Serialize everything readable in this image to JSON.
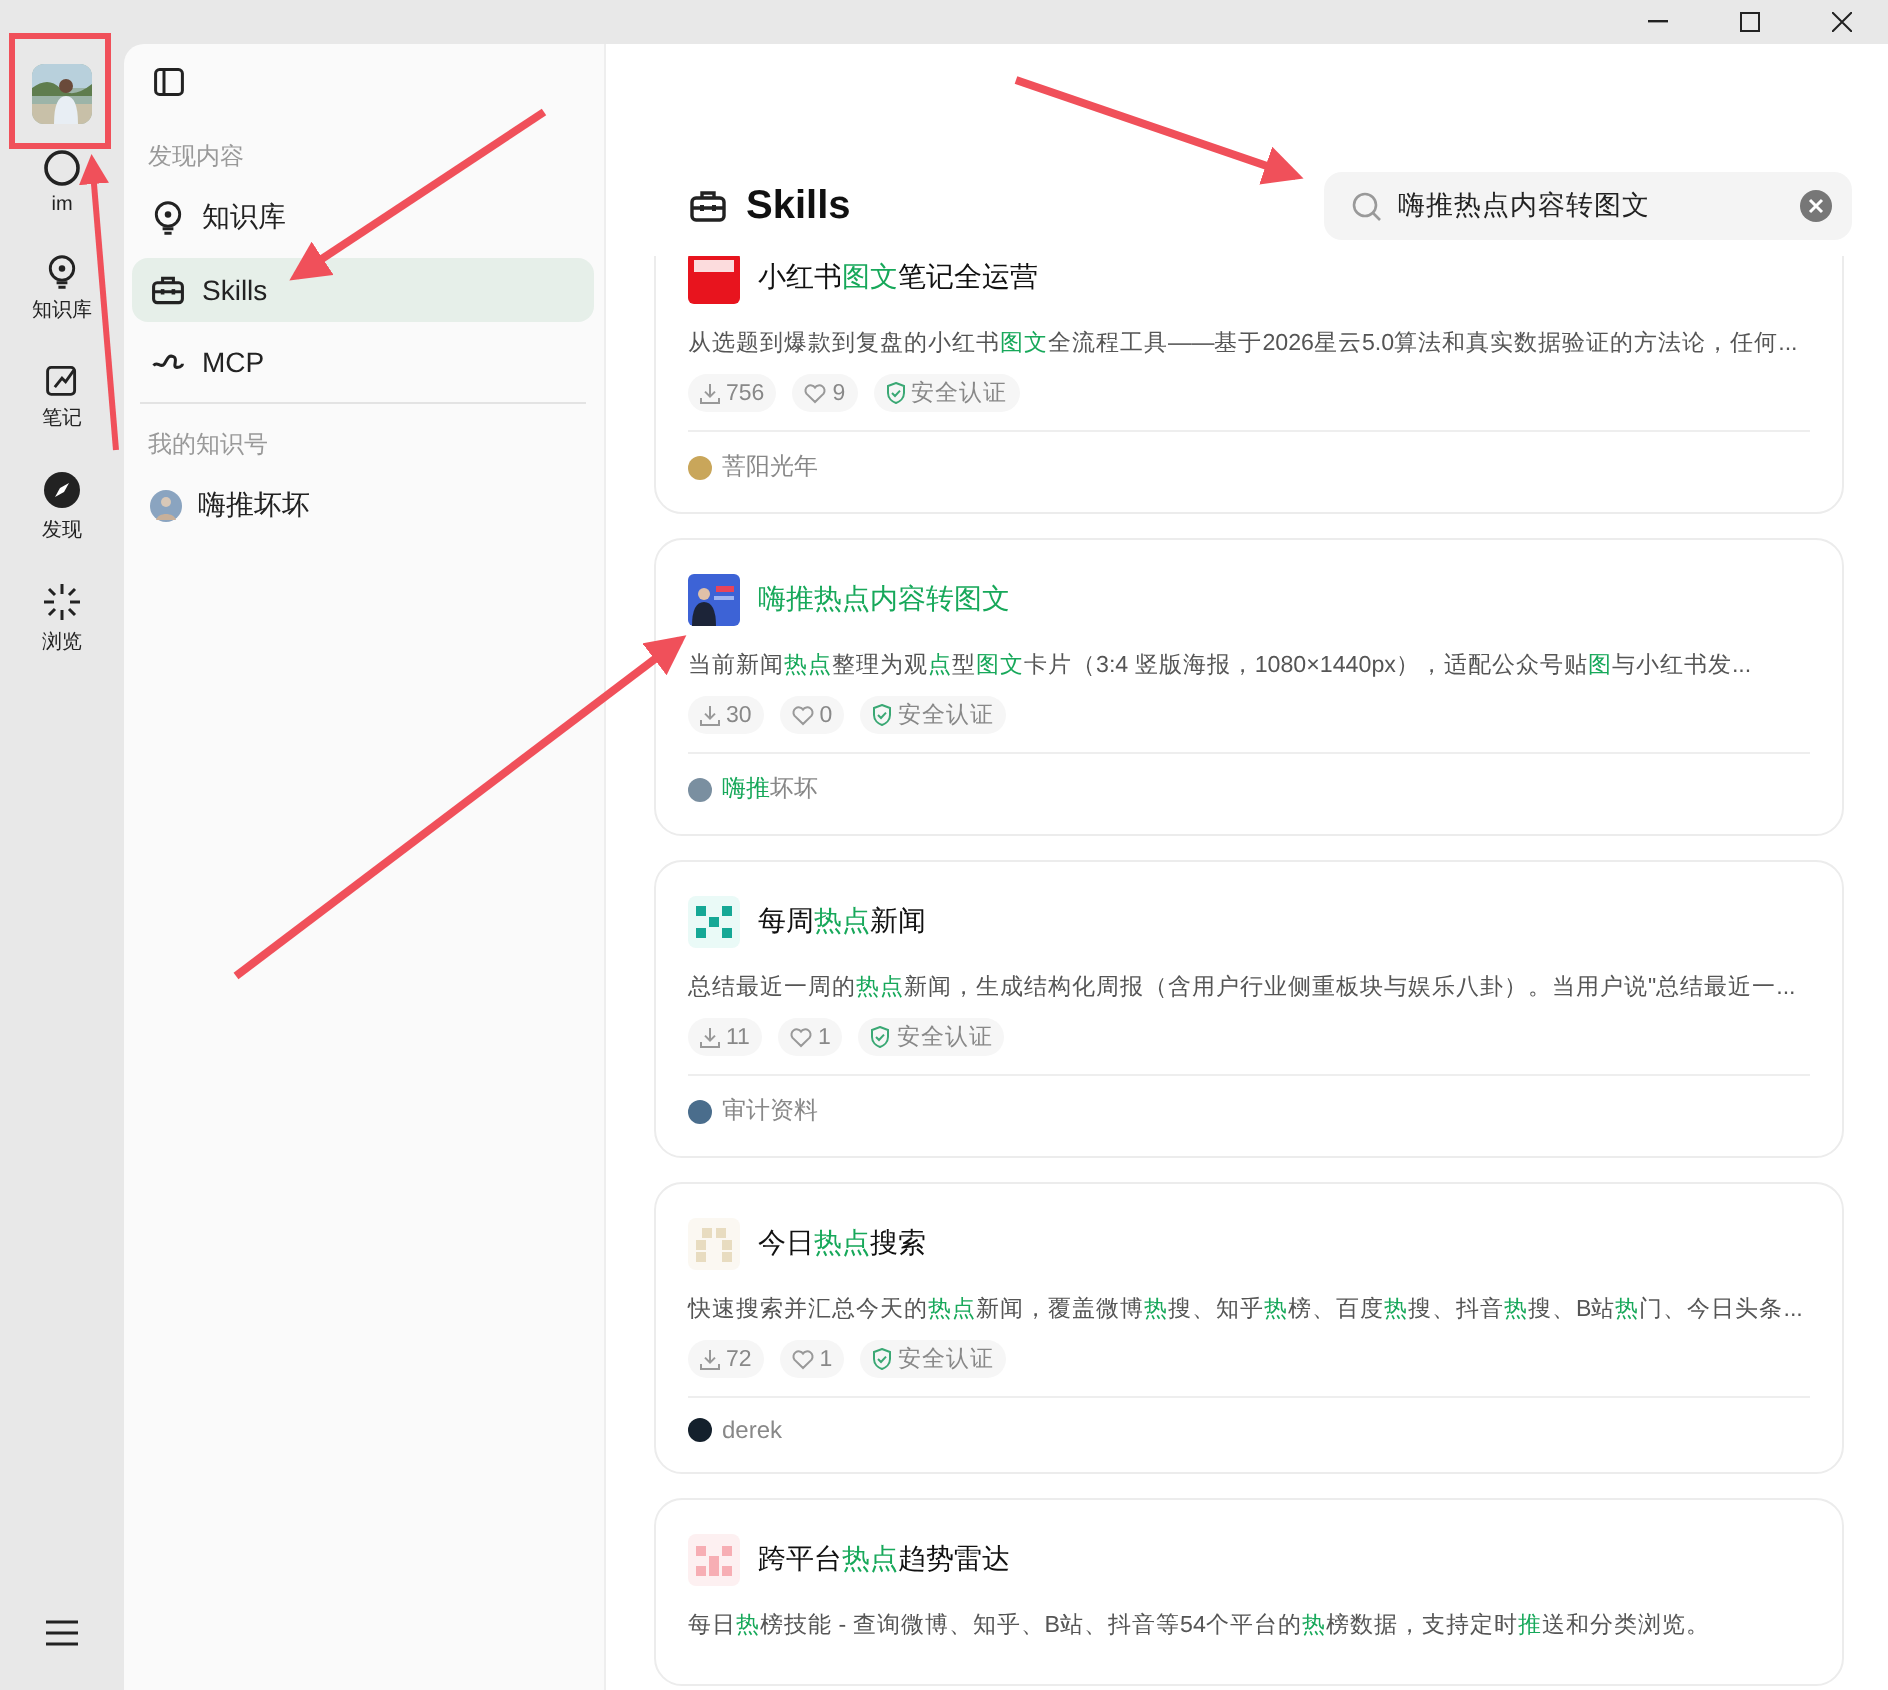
{
  "rail": {
    "items": [
      {
        "label": "im",
        "kind": "circle"
      },
      {
        "label": "知识库",
        "kind": "bulb"
      },
      {
        "label": "笔记",
        "kind": "note"
      },
      {
        "label": "发现",
        "kind": "compass"
      },
      {
        "label": "浏览",
        "kind": "burst"
      }
    ]
  },
  "sidebar": {
    "sections": [
      {
        "heading": "发现内容",
        "items": [
          {
            "label": "知识库",
            "kind": "bulb",
            "selected": false
          },
          {
            "label": "Skills",
            "kind": "toolbox",
            "selected": true
          },
          {
            "label": "MCP",
            "kind": "plug",
            "selected": false
          }
        ]
      },
      {
        "heading": "我的知识号",
        "items": [
          {
            "label": "嗨推坏坏",
            "kind": "avatar",
            "selected": false
          }
        ]
      }
    ]
  },
  "main": {
    "title": "Skills",
    "search": {
      "value": "嗨推热点内容转图文"
    },
    "cards": [
      {
        "title": [
          {
            "text": "小红书",
            "match": false
          },
          {
            "text": "图文",
            "match": true
          },
          {
            "text": "笔记全运营",
            "match": false
          }
        ],
        "description": [
          {
            "text": "从选题到爆款到复盘的小红书",
            "match": false
          },
          {
            "text": "图文",
            "match": true
          },
          {
            "text": "全流程工具——基于2026星云5.0算法和真实数据验证的方法论，任何...",
            "match": false
          }
        ],
        "downloads": "756",
        "likes": "9",
        "badge": "安全认证",
        "author": [
          {
            "text": "菩阳光年",
            "match": false
          }
        ]
      },
      {
        "title": [
          {
            "text": "嗨推热点内容转图文",
            "match": true
          }
        ],
        "description": [
          {
            "text": "当前新闻",
            "match": false
          },
          {
            "text": "热点",
            "match": true
          },
          {
            "text": "整理为观",
            "match": false
          },
          {
            "text": "点",
            "match": true
          },
          {
            "text": "型",
            "match": false
          },
          {
            "text": "图文",
            "match": true
          },
          {
            "text": "卡片（3:4 竖版海报，1080×1440px），适配公众号贴",
            "match": false
          },
          {
            "text": "图",
            "match": true
          },
          {
            "text": "与小红书发...",
            "match": false
          }
        ],
        "downloads": "30",
        "likes": "0",
        "badge": "安全认证",
        "author": [
          {
            "text": "嗨推",
            "match": true
          },
          {
            "text": "坏坏",
            "match": false
          }
        ]
      },
      {
        "title": [
          {
            "text": "每周",
            "match": false
          },
          {
            "text": "热点",
            "match": true
          },
          {
            "text": "新闻",
            "match": false
          }
        ],
        "description": [
          {
            "text": "总结最近一周的",
            "match": false
          },
          {
            "text": "热点",
            "match": true
          },
          {
            "text": "新闻，生成结构化周报（含用户行业侧重板块与娱乐八卦）。当用户说\"总结最近一...",
            "match": false
          }
        ],
        "downloads": "11",
        "likes": "1",
        "badge": "安全认证",
        "author": [
          {
            "text": "审计资料",
            "match": false
          }
        ]
      },
      {
        "title": [
          {
            "text": "今日",
            "match": false
          },
          {
            "text": "热点",
            "match": true
          },
          {
            "text": "搜索",
            "match": false
          }
        ],
        "description": [
          {
            "text": "快速搜索并汇总今天的",
            "match": false
          },
          {
            "text": "热点",
            "match": true
          },
          {
            "text": "新闻，覆盖微博",
            "match": false
          },
          {
            "text": "热",
            "match": true
          },
          {
            "text": "搜、知乎",
            "match": false
          },
          {
            "text": "热",
            "match": true
          },
          {
            "text": "榜、百度",
            "match": false
          },
          {
            "text": "热",
            "match": true
          },
          {
            "text": "搜、抖音",
            "match": false
          },
          {
            "text": "热",
            "match": true
          },
          {
            "text": "搜、B站",
            "match": false
          },
          {
            "text": "热",
            "match": true
          },
          {
            "text": "门、今日头条...",
            "match": false
          }
        ],
        "downloads": "72",
        "likes": "1",
        "badge": "安全认证",
        "author": [
          {
            "text": "derek",
            "match": false
          }
        ]
      },
      {
        "title": [
          {
            "text": "跨平台",
            "match": false
          },
          {
            "text": "热点",
            "match": true
          },
          {
            "text": "趋势雷达",
            "match": false
          }
        ],
        "description": [
          {
            "text": "每日",
            "match": false
          },
          {
            "text": "热",
            "match": true
          },
          {
            "text": "榜技能 - 查询微博、知乎、B站、抖音等54个平台的",
            "match": false
          },
          {
            "text": "热",
            "match": true
          },
          {
            "text": "榜数据，支持定时",
            "match": false
          },
          {
            "text": "推",
            "match": true
          },
          {
            "text": "送和分类浏览。",
            "match": false
          }
        ]
      }
    ]
  }
}
